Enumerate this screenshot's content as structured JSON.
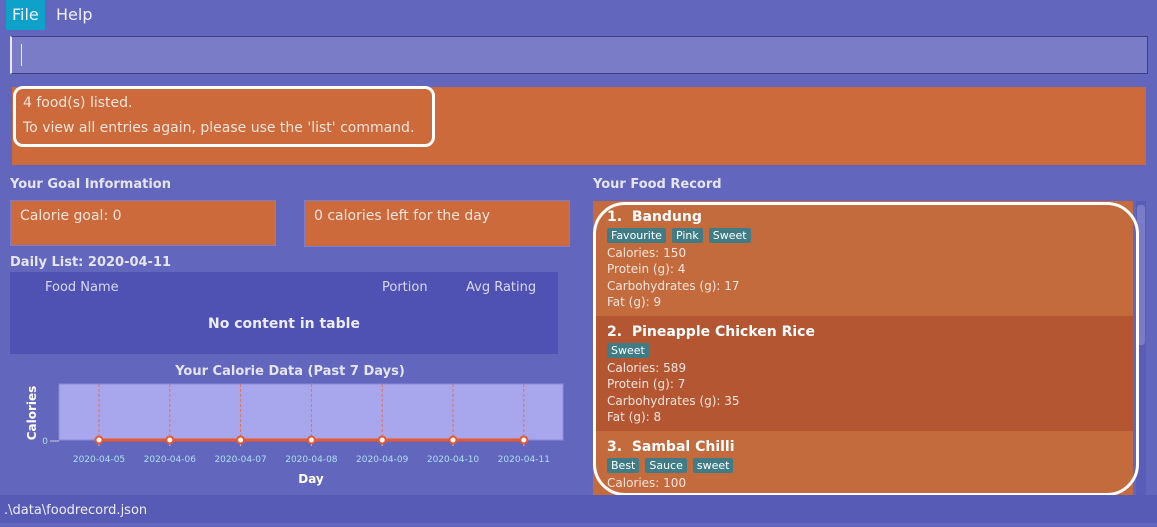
{
  "menu": {
    "items": [
      "File",
      "Help"
    ]
  },
  "command_box": {
    "value": ""
  },
  "result": {
    "lines": [
      "4 food(s) listed.",
      "To view all entries again, please use the 'list' command."
    ]
  },
  "goal": {
    "title": "Your Goal Information",
    "calorie_goal": "Calorie goal: 0",
    "calories_left": "0 calories left for the day"
  },
  "daily_list": {
    "title": "Daily List: 2020-04-11",
    "columns": [
      "Food Name",
      "Portion",
      "Avg Rating"
    ],
    "empty_text": "No content in table"
  },
  "chart_data": {
    "type": "line",
    "title": "Your Calorie Data (Past 7 Days)",
    "xlabel": "Day",
    "ylabel": "Calories",
    "categories": [
      "2020-04-05",
      "2020-04-06",
      "2020-04-07",
      "2020-04-08",
      "2020-04-09",
      "2020-04-10",
      "2020-04-11"
    ],
    "values": [
      0,
      0,
      0,
      0,
      0,
      0,
      0
    ],
    "yticks": [
      "0"
    ],
    "grid": "vertical dashed",
    "colors": {
      "line": "#e8582c",
      "plot_bg": "#a8a6ec"
    }
  },
  "food_record": {
    "title": "Your Food Record",
    "items": [
      {
        "index": "1.",
        "name": "Bandung",
        "tags": [
          "Favourite",
          "Pink",
          "Sweet"
        ],
        "fields": [
          "Calories: 150",
          "Protein (g): 4",
          "Carbohydrates (g): 17",
          "Fat (g): 9"
        ]
      },
      {
        "index": "2.",
        "name": "Pineapple Chicken Rice",
        "tags": [
          "Sweet"
        ],
        "fields": [
          "Calories: 589",
          "Protein (g): 7",
          "Carbohydrates (g): 35",
          "Fat (g): 8"
        ]
      },
      {
        "index": "3.",
        "name": "Sambal Chilli",
        "tags": [
          "Best",
          "Sauce",
          "sweet"
        ],
        "fields": [
          "Calories: 100"
        ]
      }
    ]
  },
  "status_bar": {
    "path": ".\\data\\foodrecord.json"
  },
  "colors": {
    "background": "#6366bd",
    "accent": "#cc6a3b",
    "selected_card": "#b45632",
    "tag": "#3f7c86",
    "menu_active": "#0ea1c9"
  }
}
